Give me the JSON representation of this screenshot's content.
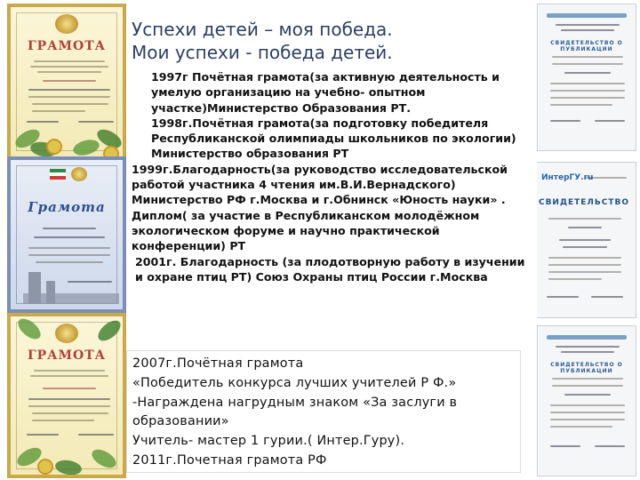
{
  "title_lines": [
    "Успехи детей – моя победа.",
    "Мои успехи -  победа детей."
  ],
  "achievements": [
    "1997г Почётная грамота(за активную деятельность и умелую организацию на учебно- опытном участке)Министерство Образования РТ.",
    "1998г.Почётная грамота(за подготовку победителя Республиканской олимпиады школьников по экологии) Министерство образования РТ",
    "1999г.Благодарность(за руководство исследовательской работой участника 4 чтения им.В.И.Вернадского) Министерство РФ г.Москва и г.Обнинск «Юность науки» .",
    "Диплом( за участие в Республиканском молодёжном экологическом форуме и научно практической конференции)  РТ",
    "2001г. Благодарность (за плодотворную работу в изучении и охране птиц РТ) Союз Охраны птиц России г.Москва"
  ],
  "later_achievements": [
    "2007г.Почётная грамота",
    "«Победитель конкурса лучших учителей Р Ф.»",
    " -Награждена нагрудным знаком «За заслуги в образовании»",
    "Учитель- мастер 1 гурии.( Интер.Гуру).",
    "2011г.Почетная грамота РФ"
  ],
  "certificates": {
    "left": [
      {
        "title": "ГРАМОТА",
        "style": "yellow"
      },
      {
        "title": "Грамота",
        "style": "blue"
      },
      {
        "title": "ГРАМОТА",
        "style": "yellow"
      }
    ],
    "right": [
      {
        "heading": "СВИДЕТЕЛЬСТВО О ПУБЛИКАЦИИ"
      },
      {
        "logo": "ИнтерГУ.ru",
        "heading": "СВИДЕТЕЛЬСТВО"
      },
      {
        "heading": "СВИДЕТЕЛЬСТВО О ПУБЛИКАЦИИ"
      }
    ]
  },
  "colors": {
    "heading": "#2b3f63",
    "cert_yellow_border": "#c9a94a",
    "cert_blue_border": "#7b8fb6",
    "cert_title_red": "#b0403a",
    "cert_title_blue": "#2c4e92"
  }
}
